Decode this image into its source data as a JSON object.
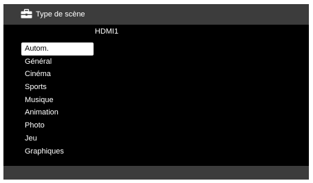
{
  "header": {
    "icon": "toolbox-icon",
    "title": "Type de scène"
  },
  "source": "HDMI1",
  "menu": {
    "selected_index": 0,
    "items": [
      "Autom.",
      "Général",
      "Cinéma",
      "Sports",
      "Musique",
      "Animation",
      "Photo",
      "Jeu",
      "Graphiques"
    ]
  },
  "colors": {
    "background": "#000000",
    "bar": "#3c3c3c",
    "text": "#ffffff",
    "highlight": "#ffffff"
  }
}
